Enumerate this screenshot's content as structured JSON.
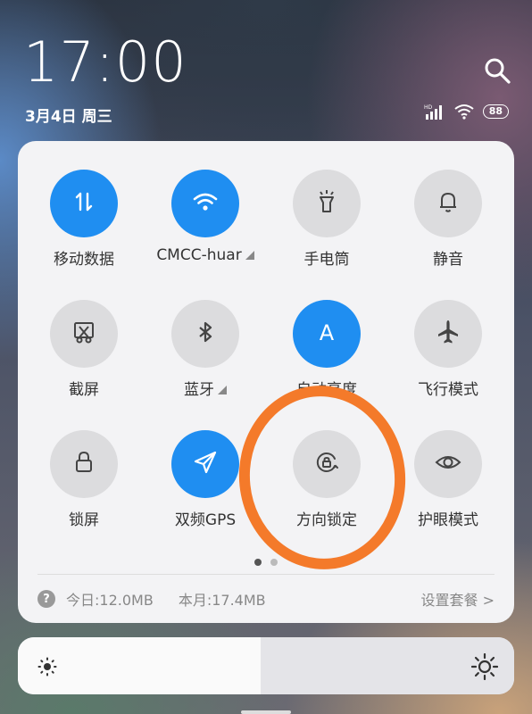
{
  "status": {
    "time": "17:00",
    "date": "3月4日 周三",
    "battery": "88",
    "signal_label": "HD"
  },
  "tiles": [
    {
      "label": "移动数据",
      "on": true,
      "icon": "mobile-data-icon"
    },
    {
      "label": "CMCC-huar",
      "on": true,
      "icon": "wifi-icon",
      "expandable": true
    },
    {
      "label": "手电筒",
      "on": false,
      "icon": "flashlight-icon"
    },
    {
      "label": "静音",
      "on": false,
      "icon": "bell-icon"
    },
    {
      "label": "截屏",
      "on": false,
      "icon": "screenshot-icon"
    },
    {
      "label": "蓝牙",
      "on": false,
      "icon": "bluetooth-icon",
      "expandable": true
    },
    {
      "label": "自动亮度",
      "on": true,
      "icon": "auto-brightness-icon"
    },
    {
      "label": "飞行模式",
      "on": false,
      "icon": "airplane-icon"
    },
    {
      "label": "锁屏",
      "on": false,
      "icon": "lock-icon"
    },
    {
      "label": "双频GPS",
      "on": true,
      "icon": "gps-icon"
    },
    {
      "label": "方向锁定",
      "on": false,
      "icon": "rotation-lock-icon"
    },
    {
      "label": "护眼模式",
      "on": false,
      "icon": "eye-icon"
    }
  ],
  "usage": {
    "today": "今日:12.0MB",
    "month": "本月:17.4MB",
    "plan_link": "设置套餐 >",
    "help": "?"
  },
  "brightness": {
    "level": 0.49
  },
  "colors": {
    "accent": "#1f8ef1",
    "annotation": "#f47a2a"
  }
}
